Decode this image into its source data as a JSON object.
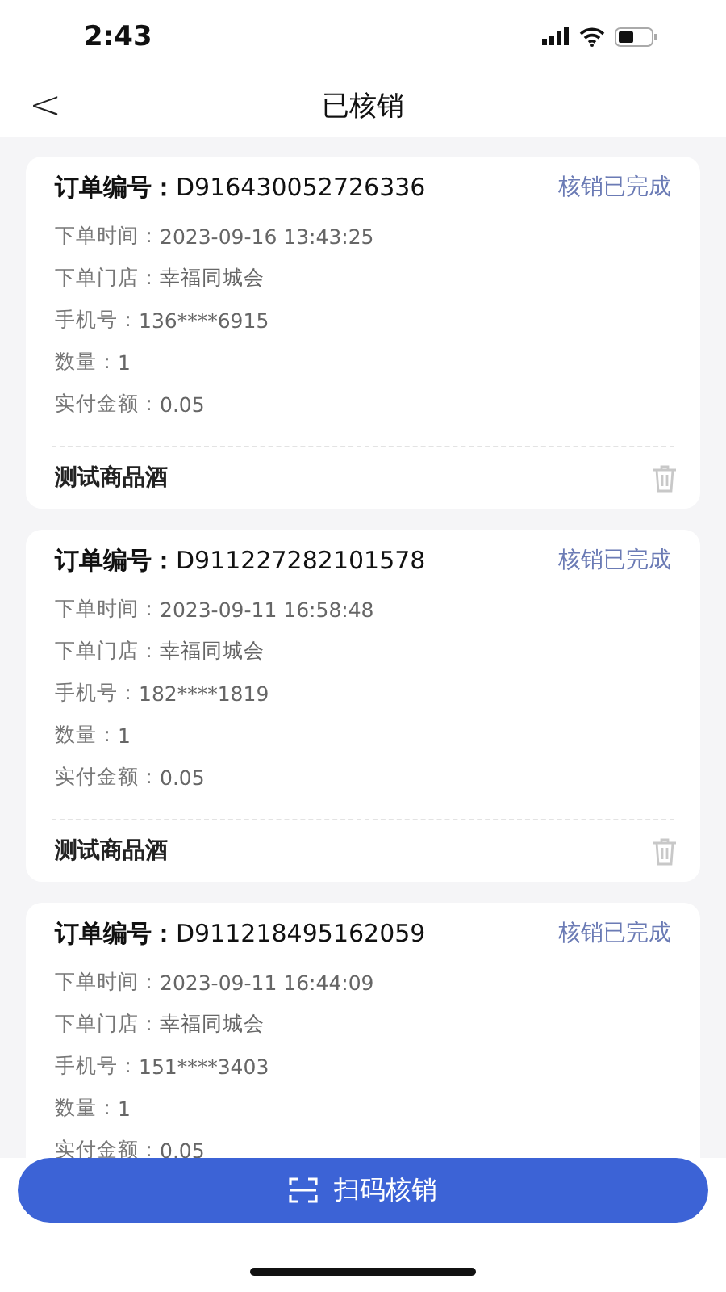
{
  "status_bar": {
    "time": "2:43"
  },
  "nav": {
    "back": "<",
    "title": "已核销"
  },
  "orders": [
    {
      "number_label": "订单编号：",
      "number": "D916430052726336",
      "status": "核销已完成",
      "fields": [
        {
          "label": "下单时间：",
          "value": "2023-09-16 13:43:25"
        },
        {
          "label": "下单门店：",
          "value": "幸福同城会"
        },
        {
          "label": "手机号：",
          "value": "136****6915"
        },
        {
          "label": "数量：",
          "value": "1"
        },
        {
          "label": "实付金额：",
          "value": "0.05"
        }
      ],
      "product": "测试商品酒"
    },
    {
      "number_label": "订单编号：",
      "number": "D911227282101578",
      "status": "核销已完成",
      "fields": [
        {
          "label": "下单时间：",
          "value": "2023-09-11 16:58:48"
        },
        {
          "label": "下单门店：",
          "value": "幸福同城会"
        },
        {
          "label": "手机号：",
          "value": "182****1819"
        },
        {
          "label": "数量：",
          "value": "1"
        },
        {
          "label": "实付金额：",
          "value": "0.05"
        }
      ],
      "product": "测试商品酒"
    },
    {
      "number_label": "订单编号：",
      "number": "D911218495162059",
      "status": "核销已完成",
      "fields": [
        {
          "label": "下单时间：",
          "value": "2023-09-11 16:44:09"
        },
        {
          "label": "下单门店：",
          "value": "幸福同城会"
        },
        {
          "label": "手机号：",
          "value": "151****3403"
        },
        {
          "label": "数量：",
          "value": "1"
        },
        {
          "label": "实付金额：",
          "value": "0.05"
        }
      ]
    }
  ],
  "scan_button": {
    "label": "扫码核销"
  }
}
